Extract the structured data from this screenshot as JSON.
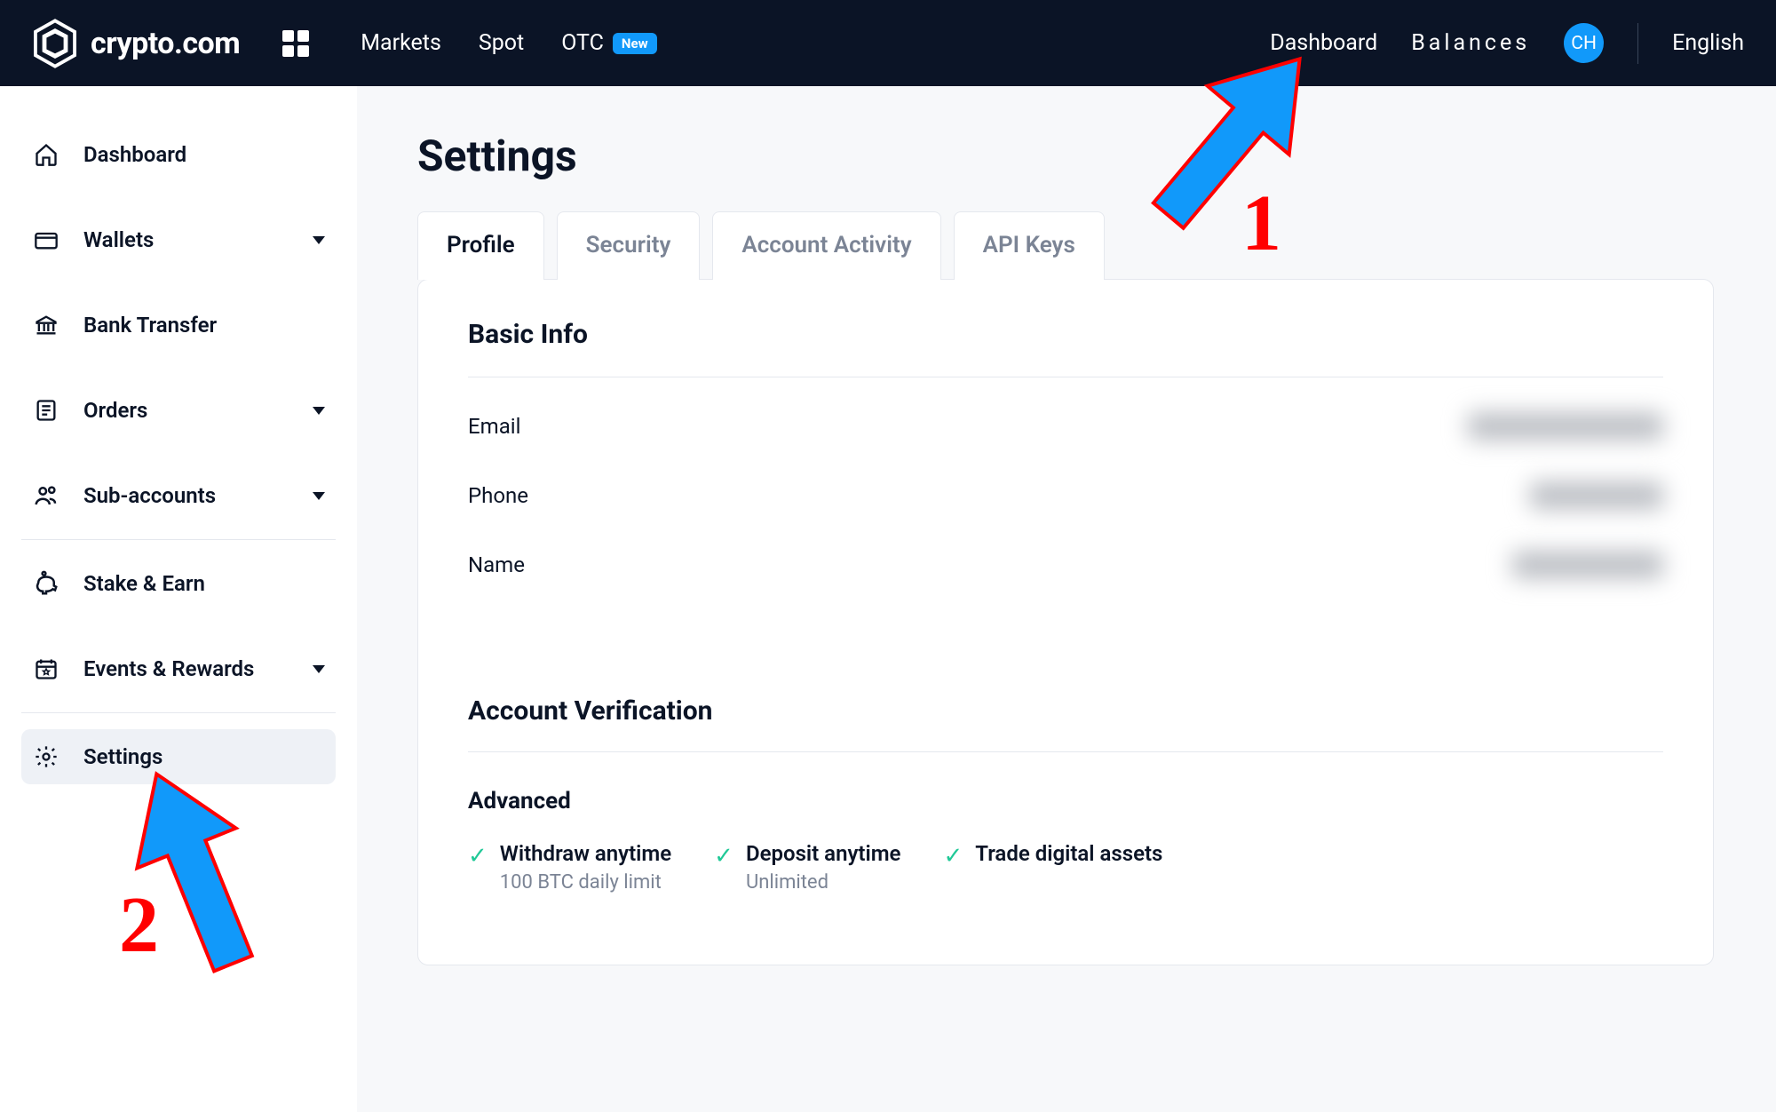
{
  "header": {
    "logo_text": "crypto.com",
    "nav": {
      "markets": "Markets",
      "spot": "Spot",
      "otc": "OTC",
      "new_badge": "New"
    },
    "right": {
      "dashboard": "Dashboard",
      "balances": "Balances",
      "avatar_initials": "CH",
      "language": "English"
    }
  },
  "sidebar": {
    "items": {
      "dashboard": "Dashboard",
      "wallets": "Wallets",
      "bank_transfer": "Bank Transfer",
      "orders": "Orders",
      "sub_accounts": "Sub-accounts",
      "stake_earn": "Stake & Earn",
      "events_rewards": "Events & Rewards",
      "settings": "Settings"
    }
  },
  "page": {
    "title": "Settings",
    "tabs": {
      "profile": "Profile",
      "security": "Security",
      "account_activity": "Account Activity",
      "api_keys": "API Keys"
    }
  },
  "profile": {
    "basic_info_title": "Basic Info",
    "fields": {
      "email": "Email",
      "phone": "Phone",
      "name": "Name"
    },
    "verification_title": "Account Verification",
    "advanced_title": "Advanced",
    "advanced_items": {
      "withdraw": {
        "label": "Withdraw anytime",
        "sub": "100 BTC daily limit"
      },
      "deposit": {
        "label": "Deposit anytime",
        "sub": "Unlimited"
      },
      "trade": {
        "label": "Trade digital assets",
        "sub": ""
      }
    }
  },
  "annotations": {
    "arrow1": "1",
    "arrow2": "2"
  }
}
